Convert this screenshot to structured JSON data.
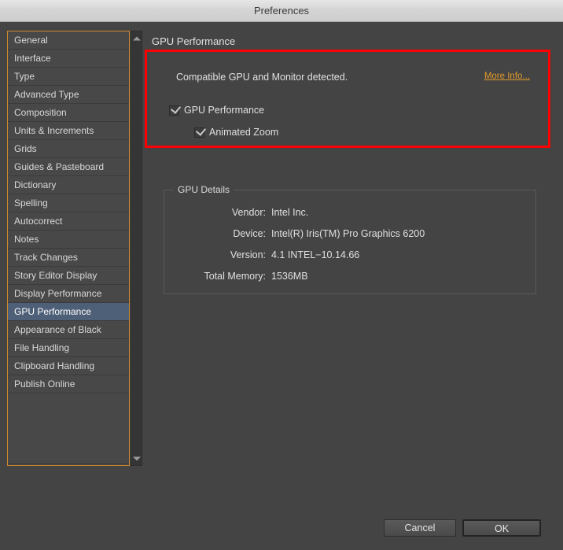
{
  "window": {
    "title": "Preferences"
  },
  "sidebar": {
    "items": [
      {
        "label": "General",
        "selected": false
      },
      {
        "label": "Interface",
        "selected": false
      },
      {
        "label": "Type",
        "selected": false
      },
      {
        "label": "Advanced Type",
        "selected": false
      },
      {
        "label": "Composition",
        "selected": false
      },
      {
        "label": "Units & Increments",
        "selected": false
      },
      {
        "label": "Grids",
        "selected": false
      },
      {
        "label": "Guides & Pasteboard",
        "selected": false
      },
      {
        "label": "Dictionary",
        "selected": false
      },
      {
        "label": "Spelling",
        "selected": false
      },
      {
        "label": "Autocorrect",
        "selected": false
      },
      {
        "label": "Notes",
        "selected": false
      },
      {
        "label": "Track Changes",
        "selected": false
      },
      {
        "label": "Story Editor Display",
        "selected": false
      },
      {
        "label": "Display Performance",
        "selected": false
      },
      {
        "label": "GPU Performance",
        "selected": true
      },
      {
        "label": "Appearance of Black",
        "selected": false
      },
      {
        "label": "File Handling",
        "selected": false
      },
      {
        "label": "Clipboard Handling",
        "selected": false
      },
      {
        "label": "Publish Online",
        "selected": false
      }
    ],
    "scrollbar": {
      "up_arrow": "scroll-up-arrow",
      "down_arrow": "scroll-down-arrow"
    }
  },
  "panel": {
    "title": "GPU Performance",
    "status_message": "Compatible GPU and Monitor detected.",
    "more_info_label": "More Info...",
    "checkboxes": [
      {
        "label": "GPU Performance",
        "checked": true
      },
      {
        "label": "Animated Zoom",
        "checked": true
      }
    ]
  },
  "details": {
    "legend": "GPU Details",
    "rows": [
      {
        "label": "Vendor:",
        "value": "Intel Inc."
      },
      {
        "label": "Device:",
        "value": "Intel(R) Iris(TM) Pro Graphics 6200"
      },
      {
        "label": "Version:",
        "value": "4.1 INTEL−10.14.66"
      },
      {
        "label": "Total Memory:",
        "value": "1536MB"
      }
    ]
  },
  "footer": {
    "cancel_label": "Cancel",
    "ok_label": "OK"
  },
  "colors": {
    "window_background": "#444444",
    "selection_blue": "#4e5f78",
    "focus_orange": "#d08a2e",
    "link_orange": "#e09a2b",
    "highlight_red": "#ff0000"
  }
}
